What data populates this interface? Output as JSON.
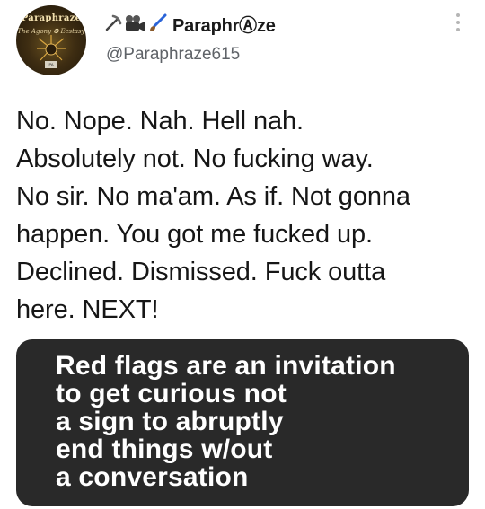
{
  "profile": {
    "avatar_logo_text": "Paraphraze",
    "avatar_logo_subtext": "The Agony ✪ Ecstasy",
    "display_name": "ParaphrⒶze",
    "display_name_emoji_icons": [
      "pick-icon",
      "movie-camera-icon",
      "paintbrush-icon"
    ],
    "handle": "@Paraphraze615"
  },
  "tweet": {
    "text_lines": [
      "No. Nope. Nah. Hell nah.",
      "Absolutely not. No fucking way.",
      "No sir. No ma'am. As if. Not gonna",
      "happen. You got me fucked up.",
      "Declined. Dismissed. Fuck outta",
      "here. NEXT!"
    ]
  },
  "image_card": {
    "text_lines": [
      "Red flags are an invitation",
      "to get curious not",
      "a sign to abruptly",
      "end things w/out",
      "a conversation"
    ]
  },
  "colors": {
    "card_background": "#292929",
    "handle_gray": "#5f6368"
  }
}
